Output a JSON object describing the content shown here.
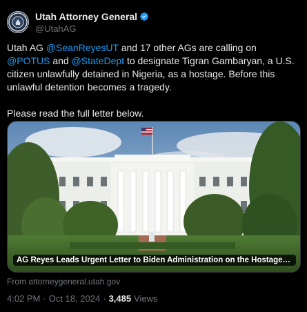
{
  "author": {
    "display_name": "Utah Attorney General",
    "handle": "@UtahAG",
    "verified_color": "#1d9bf0"
  },
  "tweet": {
    "p1_a": "Utah AG ",
    "p1_link1": "@SeanReyesUT",
    "p1_b": " and 17 other AGs are calling on ",
    "p1_link2": "@POTUS",
    "p1_c": " and ",
    "p1_link3": "@StateDept",
    "p1_d": " to designate Tigran Gambaryan, a U.S. citizen unlawfully detained in Nigeria, as a hostage. Before  this unlawful detention becomes a tragedy.",
    "p2": "Please read the full letter below."
  },
  "card": {
    "caption": "AG Reyes Leads Urgent Letter to Biden Administration on the Hostage Designation of ...",
    "source": "From attorneygeneral.utah.gov"
  },
  "meta": {
    "time": "4:02 PM",
    "date": "Oct 18, 2024",
    "views": "3,485",
    "views_label": "Views"
  },
  "colors": {
    "background": "#000000",
    "text": "#e7e9ea",
    "secondary": "#71767b",
    "link": "#1d9bf0"
  }
}
